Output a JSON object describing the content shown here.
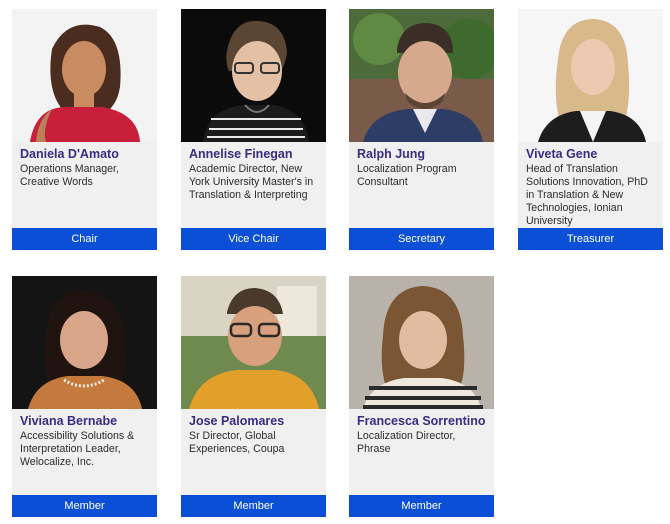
{
  "members": [
    {
      "name": "Daniela D'Amato",
      "title": "Operations Manager, Creative Words",
      "role": "Chair"
    },
    {
      "name": "Annelise Finegan",
      "title": "Academic Director, New York University Master's in Translation & Interpreting",
      "role": "Vice Chair"
    },
    {
      "name": "Ralph Jung",
      "title": "Localization Program Consultant",
      "role": "Secretary"
    },
    {
      "name": "Viveta Gene",
      "title": "Head of Translation Solutions Innovation, PhD in Translation & New Technologies, Ionian University",
      "role": "Treasurer"
    },
    {
      "name": "Viviana Bernabe",
      "title": "Accessibility Solutions & Interpretation Leader, Welocalize, Inc.",
      "role": "Member"
    },
    {
      "name": "Jose Palomares",
      "title": "Sr Director, Global Experiences, Coupa",
      "role": "Member"
    },
    {
      "name": "Francesca Sorrentino",
      "title": "Localization Director, Phrase",
      "role": "Member"
    }
  ]
}
